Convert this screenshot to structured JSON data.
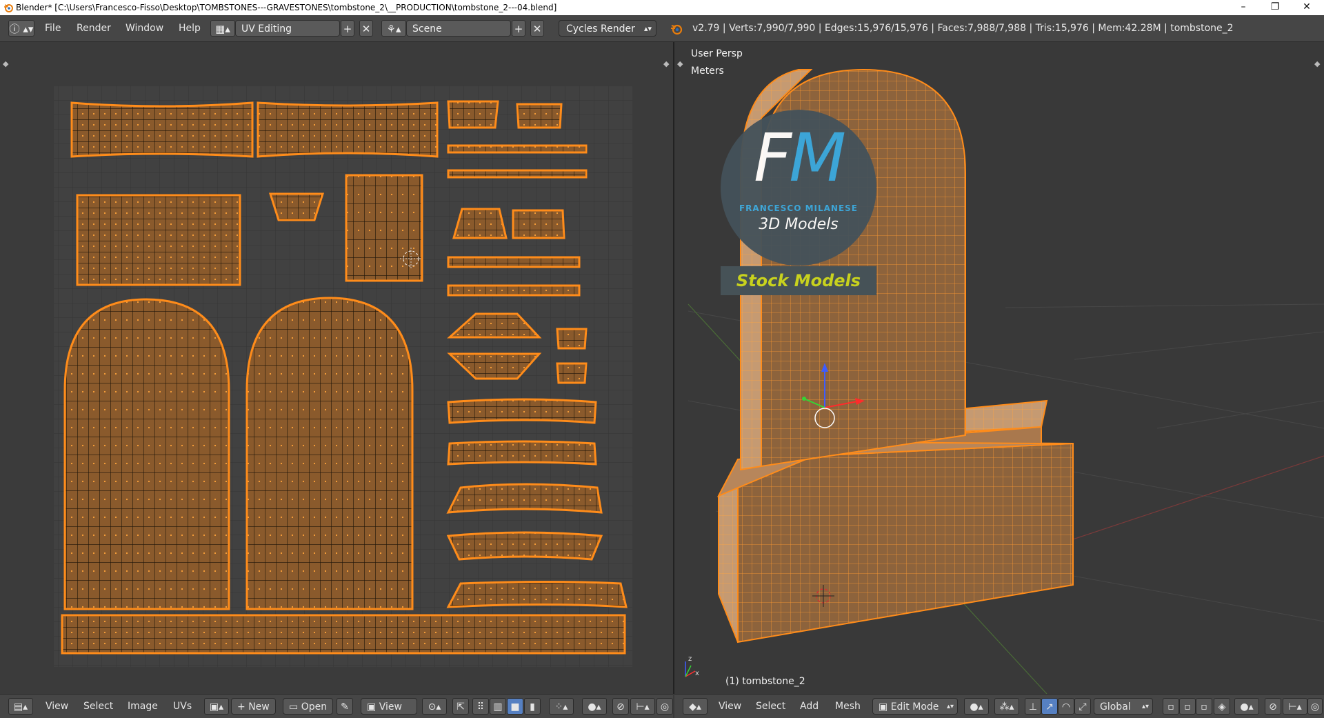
{
  "window": {
    "title": "Blender* [C:\\Users\\Francesco-Fisso\\Desktop\\TOMBSTONES---GRAVESTONES\\tombstone_2\\__PRODUCTION\\tombstone_2---04.blend]",
    "minimize": "–",
    "maximize": "❐",
    "close": "✕"
  },
  "infobar": {
    "menus": [
      "File",
      "Render",
      "Window",
      "Help"
    ],
    "screen_layout": "UV Editing",
    "scene": "Scene",
    "render_engine": "Cycles Render",
    "stats": "v2.79 | Verts:7,990/7,990 | Edges:15,976/15,976 | Faces:7,988/7,988 | Tris:15,976 | Mem:42.28M | tombstone_2"
  },
  "viewport": {
    "view_name": "User Persp",
    "units": "Meters",
    "object_label": "(1) tombstone_2"
  },
  "watermark": {
    "logo_letters": "FM",
    "author": "FRANCESCO MILANESE",
    "subtitle": "3D Models",
    "tagline": "Stock Models"
  },
  "uv_footer": {
    "menus": [
      "View",
      "Select",
      "Image",
      "UVs"
    ],
    "new_label": "New",
    "open_label": "Open",
    "view_label": "View"
  },
  "view3d_footer": {
    "menus": [
      "View",
      "Select",
      "Add",
      "Mesh"
    ],
    "mode": "Edit Mode",
    "orientation": "Global"
  },
  "colors": {
    "accent_orange": "#ff8c1a",
    "uv_face_fill": "#8a5a2c",
    "background": "#393939",
    "header": "#464646",
    "selected_button": "#5680c2",
    "logo_blue": "#38a9e0",
    "tagline_yellow": "#c8d21e"
  }
}
